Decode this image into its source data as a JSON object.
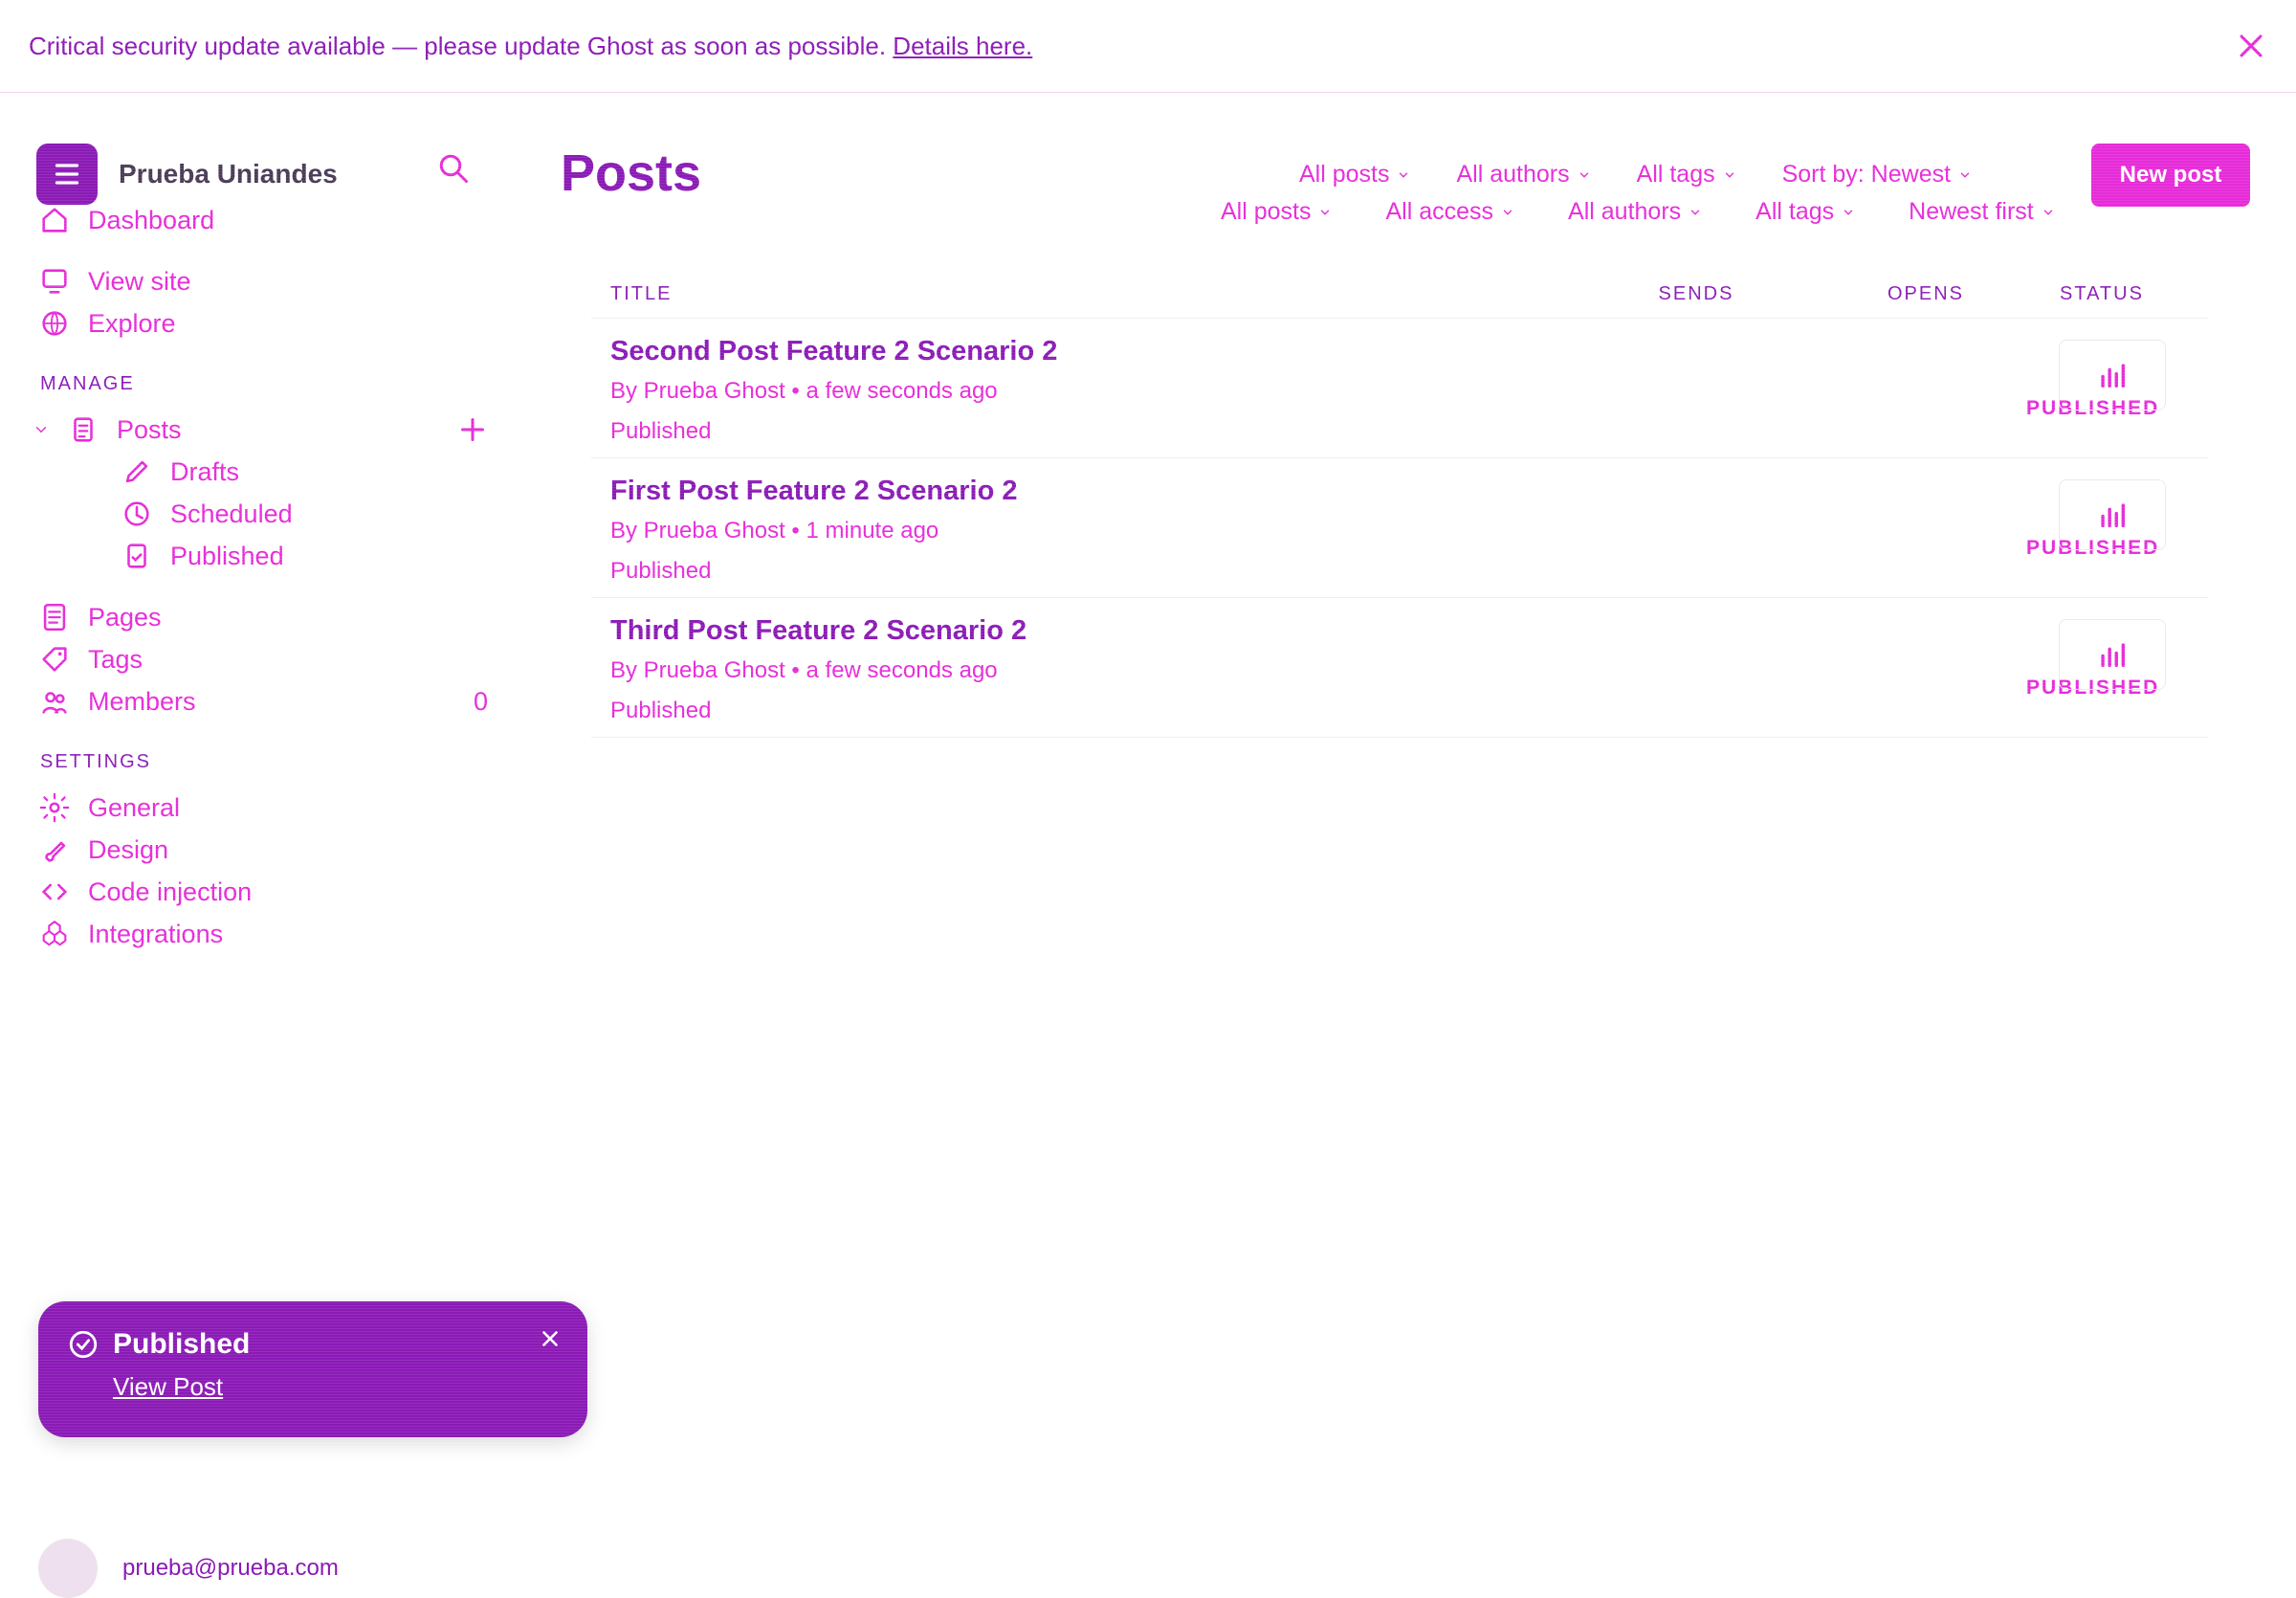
{
  "banner": {
    "message_prefix": "Critical security update available — please update Ghost as soon as possible.",
    "details_link": "Details here."
  },
  "site": {
    "name": "Prueba Uniandes"
  },
  "header": {
    "title": "Posts",
    "new_post_label": "New post"
  },
  "sidebar": {
    "top_items": [
      {
        "label": "Dashboard"
      },
      {
        "label": "View site"
      },
      {
        "label": "Explore"
      }
    ],
    "manage_label": "MANAGE",
    "manage_items": [
      {
        "label": "Posts"
      },
      {
        "label": "Drafts"
      },
      {
        "label": "Scheduled"
      },
      {
        "label": "Published"
      },
      {
        "label": "Pages"
      },
      {
        "label": "Tags"
      },
      {
        "label": "Members",
        "count": "0"
      }
    ],
    "settings_label": "SETTINGS",
    "settings_items": [
      {
        "label": "General"
      },
      {
        "label": "Design"
      },
      {
        "label": "Code injection"
      },
      {
        "label": "Integrations"
      }
    ],
    "account_email": "prueba@prueba.com"
  },
  "filters": {
    "row1": [
      "All posts",
      "All authors",
      "All tags",
      "Sort by: Newest"
    ],
    "row2": [
      "All posts",
      "All access",
      "All authors",
      "All tags",
      "Newest first"
    ]
  },
  "table": {
    "headers": {
      "title": "TITLE",
      "sends": "SENDS",
      "opens": "OPENS",
      "status": "STATUS"
    },
    "rows": [
      {
        "title": "Second Post Feature 2 Scenario 2",
        "meta": "By Prueba Ghost • a few seconds ago",
        "sub": "Published",
        "status": "PUBLISHED"
      },
      {
        "title": "First Post Feature 2 Scenario 2",
        "meta": "By Prueba Ghost • 1 minute ago",
        "sub": "Published",
        "status": "PUBLISHED"
      },
      {
        "title": "Third Post Feature 2 Scenario 2",
        "meta": "By Prueba Ghost • a few seconds ago",
        "sub": "Published",
        "status": "PUBLISHED"
      }
    ]
  },
  "toast": {
    "title": "Published",
    "link": "View Post"
  }
}
